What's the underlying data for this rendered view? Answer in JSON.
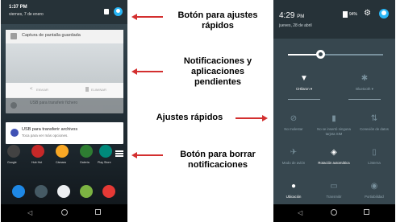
{
  "left_phone": {
    "status": {
      "time": "1:37 PM",
      "date": "viernes, 7 de enero"
    },
    "screenshot_notification": {
      "title": "Captura de pantalla guardada",
      "share_label": "ENVIAR",
      "delete_label": "ELIMINAR"
    },
    "usb_notification_faded": {
      "text": "USB para transferir fichero"
    },
    "usb_notification": {
      "title": "USB para transferir archivos",
      "subtitle": "Toca para ver más opciones."
    },
    "apps": [
      {
        "label": "Google",
        "color": "#424242"
      },
      {
        "label": "Hub Hot",
        "color": "#c62828"
      },
      {
        "label": "Cámara",
        "color": "#f9a825"
      },
      {
        "label": "Galería",
        "color": "#2e7d32"
      },
      {
        "label": "Play Store",
        "color": "#00897b"
      }
    ],
    "dock": [
      {
        "name": "phone",
        "color": "#1e88e5"
      },
      {
        "name": "camera",
        "color": "#455a64"
      },
      {
        "name": "apps",
        "color": "#eceff1"
      },
      {
        "name": "messages",
        "color": "#7cb342"
      },
      {
        "name": "browser",
        "color": "#e53935"
      }
    ]
  },
  "labels": {
    "quick_settings_button": [
      "Botón para ajustes",
      "rápidos"
    ],
    "pending": [
      "Notificaciones y",
      "aplicaciones",
      "pendientes"
    ],
    "quick_settings": "Ajustes rápidos",
    "clear_button": [
      "Botón para borrar",
      "notificaciones"
    ]
  },
  "right_phone": {
    "status": {
      "time": "4:29",
      "time_suffix": "PM",
      "date": "jueves, 28 de abril",
      "battery": "94%"
    },
    "brightness_level": 0.34,
    "tiles": [
      {
        "label": "CHilaron ▾",
        "icon": "wifi-icon",
        "glyph": "▼",
        "on": true
      },
      {
        "label": "Bluetooth ▾",
        "icon": "bluetooth-icon",
        "glyph": "✱",
        "on": false
      },
      {
        "label": "No molestar",
        "icon": "dnd-icon",
        "glyph": "⊘",
        "on": false
      },
      {
        "label": "No se insertó ninguna tarjeta SIM",
        "icon": "sim-icon",
        "glyph": "▮",
        "on": false
      },
      {
        "label": "Conexión de datos",
        "icon": "data-icon",
        "glyph": "⇅",
        "on": false
      },
      {
        "label": "Modo de avión",
        "icon": "airplane-icon",
        "glyph": "✈",
        "on": false
      },
      {
        "label": "Rotación automática",
        "icon": "rotate-icon",
        "glyph": "◈",
        "on": true
      },
      {
        "label": "Linterna",
        "icon": "flashlight-icon",
        "glyph": "▯",
        "on": false
      },
      {
        "label": "Ubicación",
        "icon": "location-icon",
        "glyph": "●",
        "on": true
      },
      {
        "label": "Transmitir",
        "icon": "cast-icon",
        "glyph": "▭",
        "on": false
      },
      {
        "label": "Portiabilidad",
        "icon": "hotspot-icon",
        "glyph": "◉",
        "on": false
      }
    ]
  }
}
